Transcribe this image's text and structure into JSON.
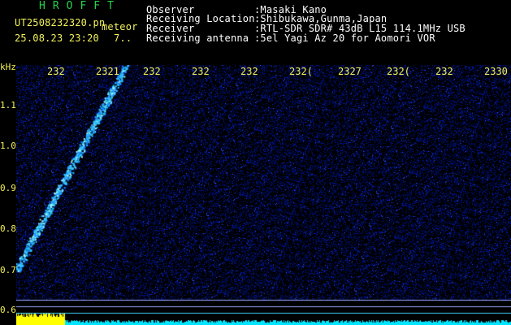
{
  "app": {
    "title": "HROFFT",
    "meteor_label": "meteor"
  },
  "file": {
    "name": "UT2508232320.pn",
    "datetime": "25.08.23 23:20",
    "count": "7.."
  },
  "info": {
    "observer_label": "Observer",
    "observer_value": ":Masaki Kano",
    "location_label": "Receiving Location",
    "location_value": ":Shibukawa,Gunma,Japan",
    "receiver_label": "Receiver",
    "receiver_value": ":RTL-SDR SDR# 43dB L15 114.1MHz USB",
    "antenna_label": "Receiving antenna",
    "antenna_value": ":5el Yagi Az 20 for Aomori VOR"
  },
  "axes": {
    "y_unit": "kHz",
    "y_ticks": [
      "1.1",
      "1.0",
      "0.9",
      "0.8",
      "0.7",
      "0.6"
    ],
    "x_ticks": [
      "232",
      "2321",
      "232",
      "232",
      "232",
      "232(",
      "2327",
      "232(",
      "232",
      "2330"
    ]
  },
  "colors": {
    "background": "#000000",
    "waterfall_noise": "#0a1fa0",
    "signal": "#2ec8ff",
    "text_yellow": "#f2f25a",
    "title_green": "#22d64a",
    "baseline_cyan": "#00e5ff",
    "level_yellow": "#ffff00"
  }
}
